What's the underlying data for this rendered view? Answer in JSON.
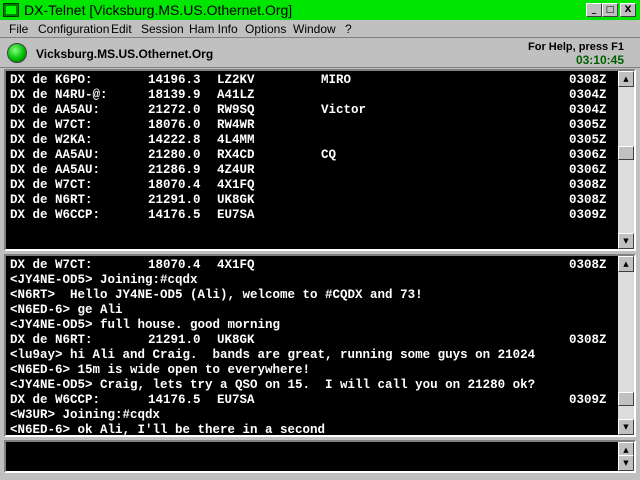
{
  "window": {
    "title": "DX-Telnet [Vicksburg.MS.US.Othernet.Org]",
    "min_glyph": "_",
    "max_glyph": "□",
    "close_glyph": "X"
  },
  "menu": [
    {
      "label": "File"
    },
    {
      "label": "Configuration"
    },
    {
      "label": "Edit"
    },
    {
      "label": "Session"
    },
    {
      "label": "Ham Info"
    },
    {
      "label": "Options"
    },
    {
      "label": "Window"
    },
    {
      "label": "?"
    }
  ],
  "status": {
    "host": "Vicksburg.MS.US.Othernet.Org",
    "help": "For Help, press F1",
    "time": "03:10:45"
  },
  "spots": [
    {
      "prefix": "DX de K6PO:",
      "freq": "14196.3",
      "call": "LZ2KV",
      "comment": "MIRO",
      "time": "0308Z"
    },
    {
      "prefix": "DX de N4RU-@:",
      "freq": "18139.9",
      "call": "A41LZ",
      "comment": "",
      "time": "0304Z"
    },
    {
      "prefix": "DX de AA5AU:",
      "freq": "21272.0",
      "call": "RW9SQ",
      "comment": "Victor",
      "time": "0304Z"
    },
    {
      "prefix": "DX de W7CT:",
      "freq": "18076.0",
      "call": "RW4WR",
      "comment": "",
      "time": "0305Z"
    },
    {
      "prefix": "DX de W2KA:",
      "freq": "14222.8",
      "call": "4L4MM",
      "comment": "",
      "time": "0305Z"
    },
    {
      "prefix": "DX de AA5AU:",
      "freq": "21280.0",
      "call": "RX4CD",
      "comment": "CQ",
      "time": "0306Z"
    },
    {
      "prefix": "DX de AA5AU:",
      "freq": "21286.9",
      "call": "4Z4UR",
      "comment": "",
      "time": "0306Z"
    },
    {
      "prefix": "DX de W7CT:",
      "freq": "18070.4",
      "call": "4X1FQ",
      "comment": "",
      "time": "0308Z"
    },
    {
      "prefix": "DX de N6RT:",
      "freq": "21291.0",
      "call": "UK8GK",
      "comment": "",
      "time": "0308Z"
    },
    {
      "prefix": "DX de W6CCP:",
      "freq": "14176.5",
      "call": "EU7SA",
      "comment": "",
      "time": "0309Z"
    }
  ],
  "chat": [
    {
      "prefix": "DX de W7CT:",
      "freq": "18070.4",
      "call": "4X1FQ",
      "time": "0308Z"
    },
    {
      "text": "<JY4NE-OD5> Joining:#cqdx"
    },
    {
      "text": "<N6RT>  Hello JY4NE-OD5 (Ali), welcome to #CQDX and 73!"
    },
    {
      "text": "<N6ED-6> ge Ali"
    },
    {
      "text": "<JY4NE-OD5> full house. good morning"
    },
    {
      "prefix": "DX de N6RT:",
      "freq": "21291.0",
      "call": "UK8GK",
      "time": "0308Z"
    },
    {
      "text": "<lu9ay> hi Ali and Craig.  bands are great, running some guys on 21024"
    },
    {
      "text": "<N6ED-6> 15m is wide open to everywhere!"
    },
    {
      "text": "<JY4NE-OD5> Craig, lets try a QSO on 15.  I will call you on 21280 ok?"
    },
    {
      "prefix": "DX de W6CCP:",
      "freq": "14176.5",
      "call": "EU7SA",
      "time": "0309Z"
    },
    {
      "text": "<W3UR> Joining:#cqdx"
    },
    {
      "text": "<N6ED-6> ok Ali, I'll be there in a second"
    }
  ],
  "input": {
    "value": ""
  },
  "scroll": {
    "top_pane_position": 0.45,
    "bottom_pane_position": 0.9
  },
  "colors": {
    "titlebar": "#00e600",
    "background": "#c0c0c0",
    "terminal_bg": "#000000",
    "terminal_fg": "#ffffff",
    "clock": "#006000"
  },
  "icons": {
    "app": "dx-telnet-app-icon",
    "status": "connection-led-icon"
  }
}
